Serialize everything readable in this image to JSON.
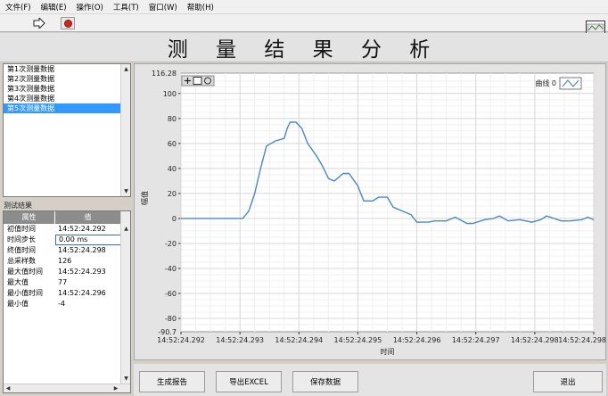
{
  "menu": [
    "文件(F)",
    "编辑(E)",
    "操作(O)",
    "工具(T)",
    "窗口(W)",
    "帮助(H)"
  ],
  "title": "测 量 结 果 分 析",
  "list": {
    "items": [
      "第1次测量数据",
      "第2次测量数据",
      "第3次测量数据",
      "第4次测量数据",
      "第5次测量数据"
    ],
    "selected_index": 4
  },
  "results": {
    "label": "测试结果",
    "headers": [
      "属性",
      "值"
    ],
    "rows": [
      [
        "初值时间",
        "14:52:24.292"
      ],
      [
        "时间步长",
        "0.00 ms"
      ],
      [
        "终值时间",
        "14:52:24.298"
      ],
      [
        "总采样数",
        "126"
      ],
      [
        "最大值时间",
        "14:52:24.293"
      ],
      [
        "最大值",
        "77"
      ],
      [
        "最小值时间",
        "14:52:24.296"
      ],
      [
        "最小值",
        "-4"
      ]
    ]
  },
  "buttons": {
    "report": "生成报告",
    "excel": "导出EXCEL",
    "save": "保存数据",
    "exit": "退出"
  },
  "colors": {
    "curve": "#4a87c7",
    "grid": "#d9d9d9",
    "selection": "#3399ff"
  },
  "chart_data": {
    "type": "line",
    "xlabel": "时间",
    "ylabel": "幅值",
    "ylim": [
      -90.7,
      116.28
    ],
    "xlim": [
      0,
      7
    ],
    "y_ticks": [
      -80,
      -60,
      -40,
      -20,
      0,
      20,
      40,
      60,
      80,
      100
    ],
    "y_range_labels": [
      "116.28",
      "-90.7"
    ],
    "x_ticks": [
      0,
      1,
      2,
      3,
      4,
      5,
      6,
      7
    ],
    "x_tick_labels": [
      "14:52:24.292",
      "14:52:24.293",
      "14:52:24.294",
      "14:52:24.295",
      "14:52:24.296",
      "14:52:24.297",
      "14:52:24.298",
      "14:52:24.298"
    ],
    "grid": true,
    "legend_position": "top-right",
    "series": [
      {
        "name": "曲线 0",
        "x": [
          0,
          1.05,
          1.15,
          1.25,
          1.35,
          1.45,
          1.6,
          1.75,
          1.8,
          1.85,
          1.95,
          2.05,
          2.15,
          2.3,
          2.4,
          2.5,
          2.6,
          2.75,
          2.85,
          3.0,
          3.1,
          3.25,
          3.35,
          3.5,
          3.6,
          3.75,
          3.9,
          4.0,
          4.2,
          4.3,
          4.5,
          4.65,
          4.85,
          4.95,
          5.15,
          5.3,
          5.4,
          5.55,
          5.75,
          5.95,
          6.1,
          6.2,
          6.45,
          6.6,
          6.8,
          6.9,
          7.0
        ],
        "y": [
          0,
          0,
          6,
          20,
          40,
          58,
          62,
          64,
          72,
          77,
          77,
          72,
          60,
          50,
          42,
          32,
          30,
          36,
          36,
          26,
          14,
          14,
          17,
          17,
          9,
          6,
          3,
          -3,
          -3,
          -2,
          -2,
          1,
          -4,
          -4,
          -1,
          0,
          2,
          -2,
          -1,
          -3,
          -1,
          2,
          -2,
          -2,
          -1,
          1,
          -1
        ]
      }
    ]
  }
}
